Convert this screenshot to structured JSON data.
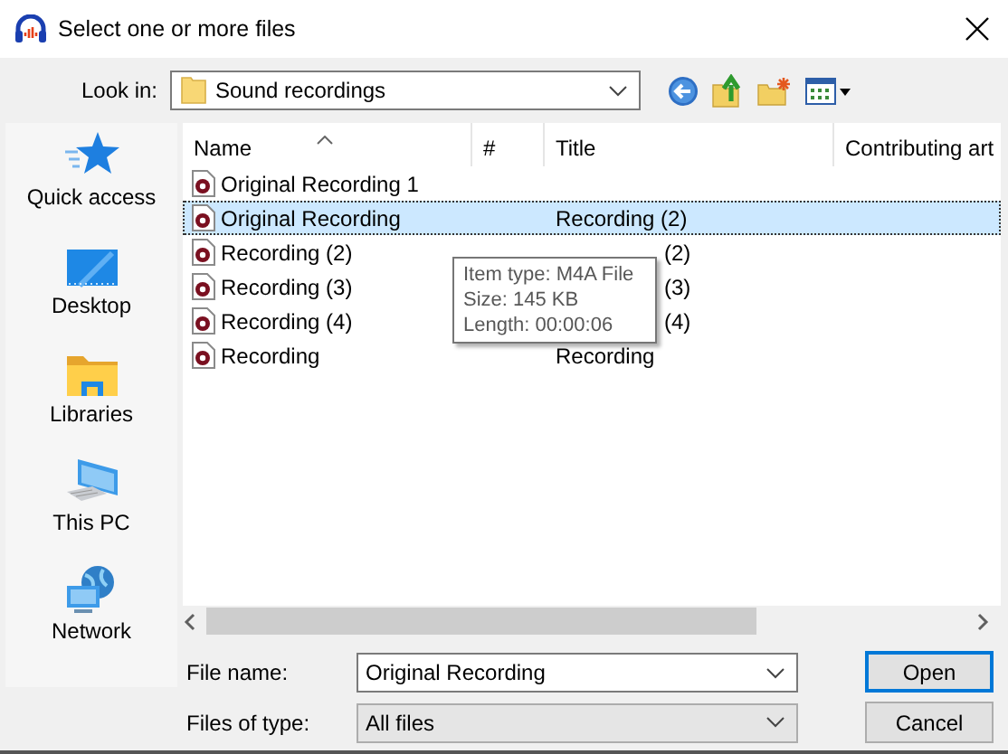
{
  "window": {
    "title": "Select one or more files"
  },
  "look_in": {
    "label": "Look in:",
    "value": "Sound recordings"
  },
  "places": [
    {
      "label": "Quick access",
      "kind": "star"
    },
    {
      "label": "Desktop",
      "kind": "desktop"
    },
    {
      "label": "Libraries",
      "kind": "libraries"
    },
    {
      "label": "This PC",
      "kind": "pc"
    },
    {
      "label": "Network",
      "kind": "network"
    }
  ],
  "table": {
    "columns": [
      {
        "label": "Name",
        "sorted": true
      },
      {
        "label": "#",
        "sorted": false
      },
      {
        "label": "Title",
        "sorted": false
      },
      {
        "label": "Contributing art",
        "sorted": false
      }
    ],
    "rows": [
      {
        "name": "Original Recording 1",
        "selected": false
      },
      {
        "name": "Original Recording",
        "title": "Recording (2)",
        "selected": true
      },
      {
        "name": "Recording (2)",
        "title": "(2)",
        "title_covered": true,
        "selected": false
      },
      {
        "name": "Recording (3)",
        "title": "(3)",
        "title_covered": true,
        "selected": false
      },
      {
        "name": "Recording (4)",
        "title": "(4)",
        "title_covered": true,
        "selected": false
      },
      {
        "name": "Recording",
        "title": "Recording",
        "selected": false
      }
    ]
  },
  "tooltip": {
    "lines": [
      "Item type: M4A File",
      "Size: 145 KB",
      "Length: 00:00:06"
    ]
  },
  "file_name": {
    "label": "File name:",
    "value": "Original Recording"
  },
  "file_type": {
    "label": "Files of type:",
    "value": "All files"
  },
  "buttons": [
    {
      "label": "Open",
      "default": true
    },
    {
      "label": "Cancel",
      "default": false
    }
  ]
}
